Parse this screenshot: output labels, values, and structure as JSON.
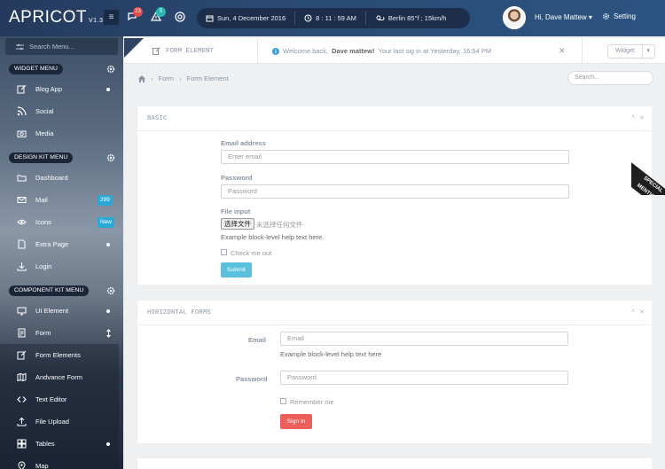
{
  "app": {
    "name": "APRICOT",
    "version": "V1.3"
  },
  "topbar": {
    "menu_icon": "hamburger-icon",
    "messages_badge": "23",
    "alerts_badge": "5",
    "date": "Sun, 4 December 2016",
    "time": "8 : 11 : 59 AM",
    "weather": "Berlin  85°f ; 15km/h",
    "user_greeting": "Hi, Dave Mattew",
    "settings_label": "Setting",
    "colors": {
      "messages_badge": "#e54848",
      "alerts_badge": "#29b8b0"
    }
  },
  "sidebar": {
    "search_placeholder": "Search Menu...",
    "sections": [
      {
        "title": "WIDGET MENU",
        "items": [
          {
            "label": "Blog App",
            "icon": "pencil-square-icon",
            "marker": "dot"
          },
          {
            "label": "Social",
            "icon": "rss-icon"
          },
          {
            "label": "Media",
            "icon": "camera-icon"
          }
        ]
      },
      {
        "title": "DESIGN KIT MENU",
        "items": [
          {
            "label": "Dashboard",
            "icon": "folder-icon"
          },
          {
            "label": "Mail",
            "icon": "envelope-icon",
            "badge": "299"
          },
          {
            "label": "Icons",
            "icon": "eye-icon",
            "badge": "New"
          },
          {
            "label": "Extra Page",
            "icon": "file-icon",
            "marker": "dot"
          },
          {
            "label": "Login",
            "icon": "download-icon"
          }
        ]
      },
      {
        "title": "COMPONENT KIT MENU",
        "items": [
          {
            "label": "UI Element",
            "icon": "monitor-icon",
            "marker": "dot"
          },
          {
            "label": "Form",
            "icon": "form-icon",
            "marker": "updown"
          },
          {
            "label": "Form Elements",
            "icon": "edit-icon"
          },
          {
            "label": "Andvance Form",
            "icon": "map-icon"
          },
          {
            "label": "Text Editor",
            "icon": "code-icon"
          },
          {
            "label": "File Upload",
            "icon": "upload-icon"
          },
          {
            "label": "Tables",
            "icon": "grid-icon",
            "marker": "dot"
          },
          {
            "label": "Map",
            "icon": "map-pin-icon"
          }
        ]
      }
    ]
  },
  "header": {
    "page_title": "FORM ELEMENT",
    "welcome_prefix": "Welcome back,",
    "welcome_name": "Dave mattew!",
    "welcome_suffix": "Your last sig in at Yesterday, 16:54 PM",
    "widget_label": "Widget",
    "breadcrumb": [
      "Form",
      "Form Element"
    ],
    "search_placeholder": "Search..."
  },
  "basic_panel": {
    "title": "BASIC",
    "email_label": "Email address",
    "email_placeholder": "Enter email",
    "password_label": "Password",
    "password_placeholder": "Password",
    "file_label": "File input",
    "file_button": "选择文件",
    "file_status": "未选择任何文件",
    "file_help": "Example block-level help text here.",
    "check_label": "Check me out",
    "submit_label": "Submit"
  },
  "horizontal_panel": {
    "title": "HORIZONTAL FORMS",
    "email_label": "Email",
    "email_placeholder": "Email",
    "email_help": "Example block-level help text here",
    "password_label": "Password",
    "password_placeholder": "Password",
    "remember_label": "Remember me",
    "signin_label": "Sign in"
  },
  "ribbon": {
    "line1": "SPECIAL",
    "line2": "MENTION"
  }
}
